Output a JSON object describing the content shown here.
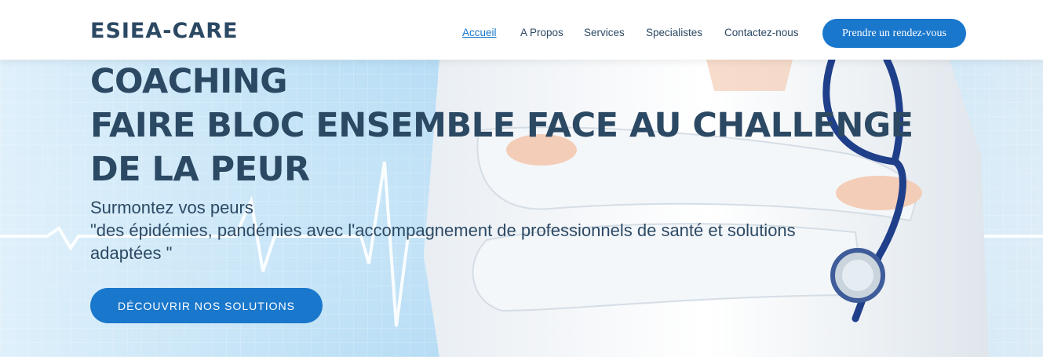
{
  "header": {
    "logo": "ESIEA-CARE",
    "nav": [
      {
        "label": "Accueil",
        "active": true
      },
      {
        "label": "A Propos",
        "active": false
      },
      {
        "label": "Services",
        "active": false
      },
      {
        "label": "Specialistes",
        "active": false
      },
      {
        "label": "Contactez-nous",
        "active": false
      }
    ],
    "cta_label": "Prendre un rendez-vous"
  },
  "hero": {
    "title_lines": [
      "COACHING",
      "FAIRE BLOC ENSEMBLE FACE AU CHALLENGE",
      "DE LA PEUR"
    ],
    "subtitle_lines": [
      "Surmontez vos peurs",
      "\"des épidémies, pandémies avec l'accompagnement de professionnels de santé et solutions",
      "adaptées \""
    ],
    "cta_label": "DÉCOUVRIR NOS SOLUTIONS",
    "background_image": "doctor-with-stethoscope-and-heartbeat-line"
  },
  "colors": {
    "primary": "#1977cc",
    "text_dark": "#2c4964",
    "hero_bg": "#bfe1f6",
    "white": "#ffffff"
  }
}
